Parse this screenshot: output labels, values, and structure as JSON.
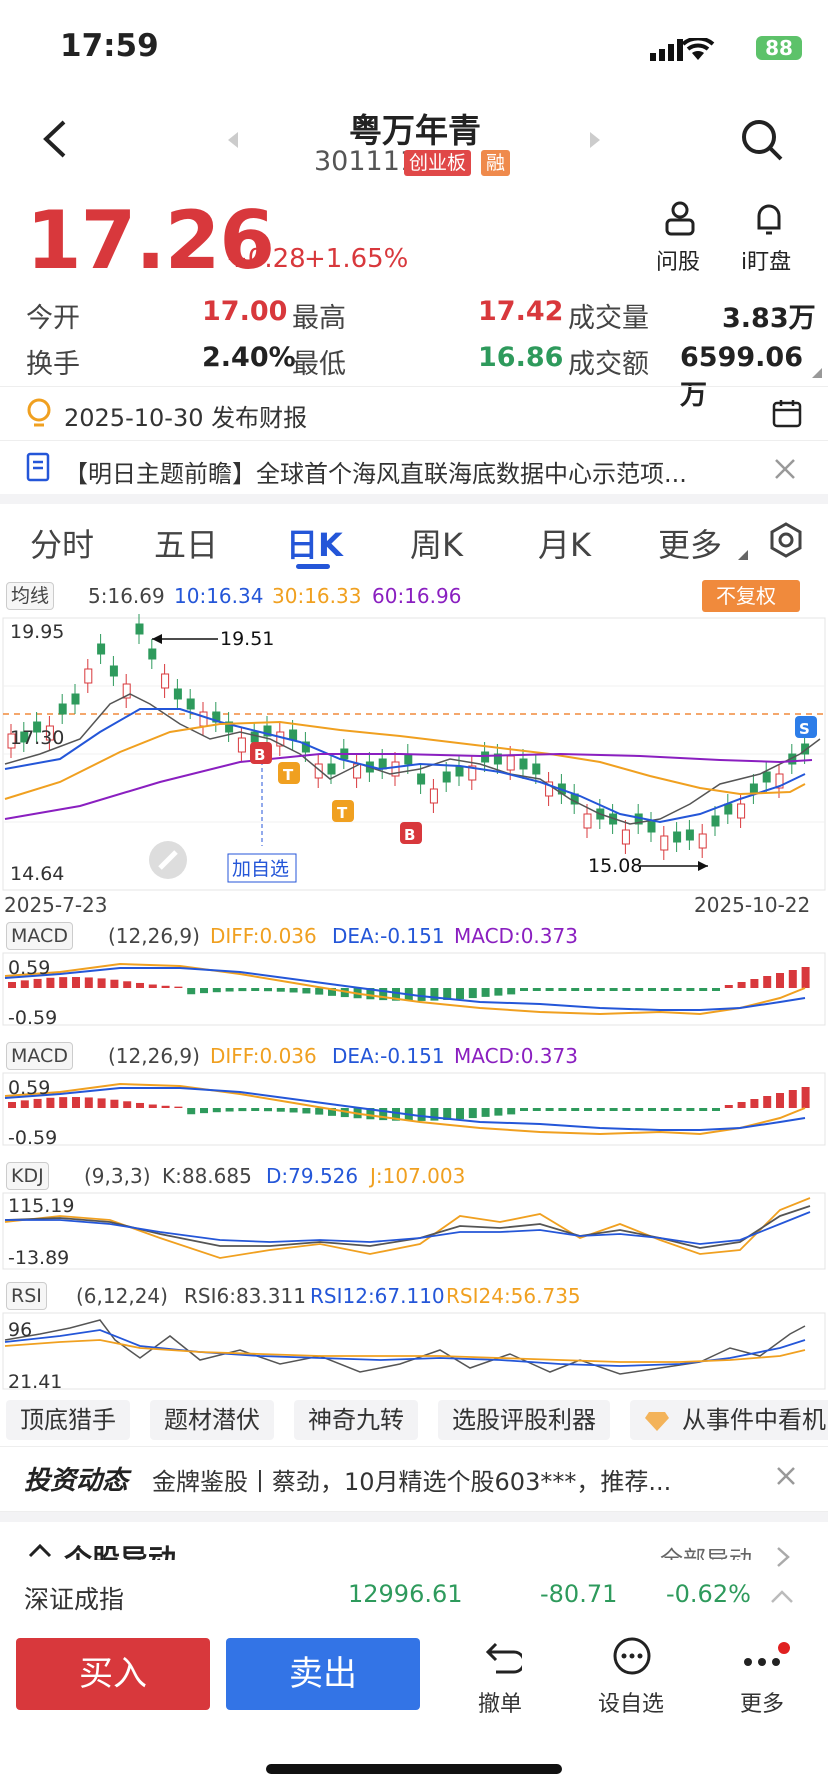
{
  "status": {
    "time": "17:59",
    "battery": "88"
  },
  "header": {
    "title": "粤万年青",
    "code": "301111",
    "badge1": "创业板",
    "badge2": "融",
    "ask_label": "问股",
    "watch_label": "i盯盘"
  },
  "quote": {
    "price": "17.26",
    "change": "+0.28",
    "change_pct": "+1.65%",
    "open_label": "今开",
    "open": "17.00",
    "high_label": "最高",
    "high": "17.42",
    "vol_label": "成交量",
    "vol": "3.83万",
    "turnover_label": "换手",
    "turnover": "2.40%",
    "low_label": "最低",
    "low": "16.86",
    "amount_label": "成交额",
    "amount": "6599.06万"
  },
  "notice": {
    "report": "2025-10-30 发布财报",
    "news": "【明日主题前瞻】全球首个海风直联海底数据中心示范项..."
  },
  "tabs": [
    "分时",
    "五日",
    "日K",
    "周K",
    "月K",
    "更多"
  ],
  "ma": {
    "label": "均线",
    "ma5": "5:16.69",
    "ma10": "10:16.34",
    "ma30": "30:16.33",
    "ma60": "60:16.96",
    "adjust": "不复权"
  },
  "kline": {
    "ymax": "19.95",
    "ymid": "17.30",
    "ymin": "14.64",
    "high_mark": "19.51",
    "low_mark": "15.08",
    "start_date": "2025-7-23",
    "end_date": "2025-10-22",
    "add_label": "加自选",
    "mark_b": "B",
    "mark_t": "T",
    "mark_s": "S"
  },
  "macd1": {
    "label": "MACD",
    "params": "(12,26,9)",
    "diff": "DIFF:0.036",
    "dea": "DEA:-0.151",
    "macd": "MACD:0.373",
    "top": "0.59",
    "bottom": "-0.59"
  },
  "macd2": {
    "label": "MACD",
    "params": "(12,26,9)",
    "diff": "DIFF:0.036",
    "dea": "DEA:-0.151",
    "macd": "MACD:0.373",
    "top": "0.59",
    "bottom": "-0.59"
  },
  "kdj": {
    "label": "KDJ",
    "params": "(9,3,3)",
    "k": "K:88.685",
    "d": "D:79.526",
    "j": "J:107.003",
    "top": "115.19",
    "bottom": "-13.89"
  },
  "rsi": {
    "label": "RSI",
    "params": "(6,12,24)",
    "r6": "RSI6:83.311",
    "r12": "RSI12:67.110",
    "r24": "RSI24:56.735",
    "top": "96",
    "bottom": "21.41"
  },
  "chips": [
    "顶底猎手",
    "题材潜伏",
    "神奇九转",
    "选股评股利器",
    "从事件中看机"
  ],
  "invest": {
    "label": "投资动态",
    "text": "金牌鉴股丨蔡劲，10月精选个股603***，推荐..."
  },
  "section": {
    "title": "个股异动",
    "all": "全部异动"
  },
  "index": {
    "name": "深证成指",
    "value": "12996.61",
    "change": "-80.71",
    "pct": "-0.62%"
  },
  "bottom": {
    "buy": "买入",
    "sell": "卖出",
    "cancel": "撤单",
    "watch": "设自选",
    "more": "更多"
  }
}
